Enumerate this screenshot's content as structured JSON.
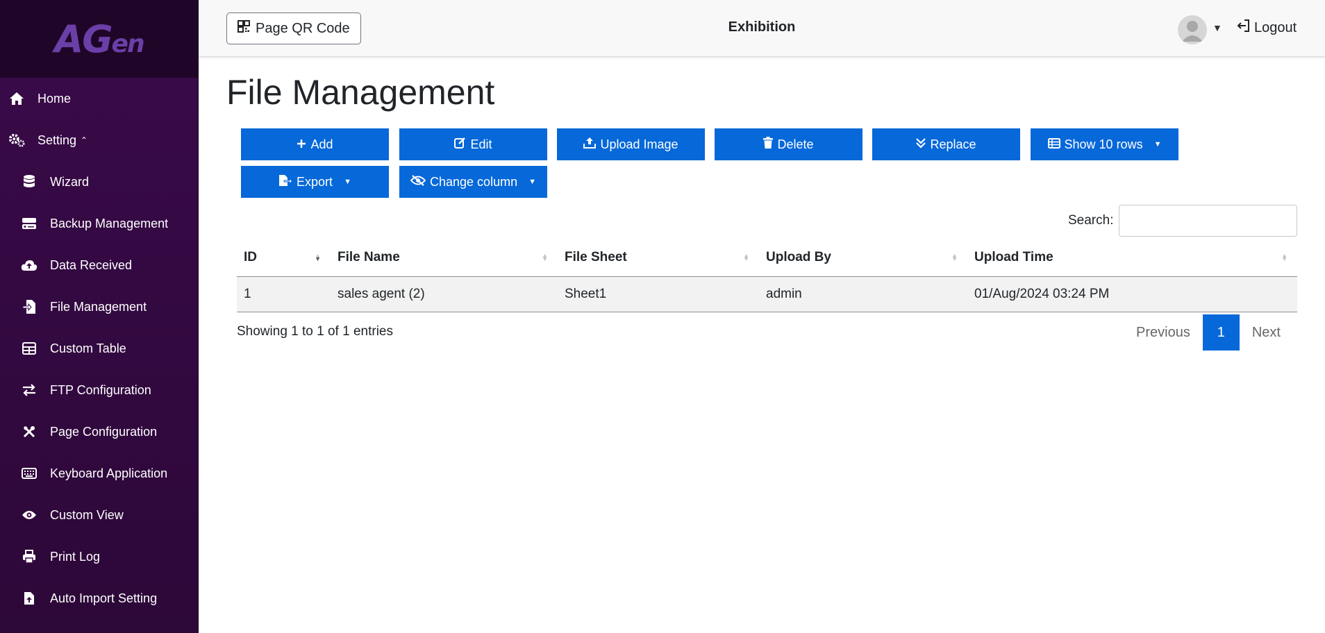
{
  "brand": {
    "logo_main": "AG",
    "logo_sub": "en"
  },
  "sidebar": {
    "items": [
      {
        "label": "Home",
        "icon": "home-icon"
      },
      {
        "label": "Setting",
        "icon": "gears-icon"
      },
      {
        "label": "Wizard",
        "icon": "database-icon"
      },
      {
        "label": "Backup Management",
        "icon": "server-icon"
      },
      {
        "label": "Data Received",
        "icon": "cloud-upload-icon"
      },
      {
        "label": "File Management",
        "icon": "file-import-icon"
      },
      {
        "label": "Custom Table",
        "icon": "table-icon"
      },
      {
        "label": "FTP Configuration",
        "icon": "exchange-icon"
      },
      {
        "label": "Page Configuration",
        "icon": "tools-icon"
      },
      {
        "label": "Keyboard Application",
        "icon": "keyboard-icon"
      },
      {
        "label": "Custom View",
        "icon": "eye-icon"
      },
      {
        "label": "Print Log",
        "icon": "printer-icon"
      },
      {
        "label": "Auto Import Setting",
        "icon": "file-upload-icon"
      }
    ]
  },
  "header": {
    "qr_button": "Page QR Code",
    "title": "Exhibition",
    "logout": "Logout"
  },
  "main": {
    "page_title": "File Management",
    "toolbar": {
      "add": "Add",
      "edit": "Edit",
      "upload_image": "Upload Image",
      "delete": "Delete",
      "replace": "Replace",
      "show_rows": "Show 10 rows",
      "export": "Export",
      "change_column": "Change column"
    },
    "search": {
      "label": "Search:",
      "value": ""
    },
    "table": {
      "columns": [
        "ID",
        "File Name",
        "File Sheet",
        "Upload By",
        "Upload Time"
      ],
      "rows": [
        [
          "1",
          "sales agent (2)",
          "Sheet1",
          "admin",
          "01/Aug/2024 03:24 PM"
        ]
      ]
    },
    "info": "Showing 1 to 1 of 1 entries",
    "pagination": {
      "previous": "Previous",
      "current": "1",
      "next": "Next"
    }
  },
  "colors": {
    "sidebar_bg": "#3a0a4a",
    "accent": "#0668d9",
    "logo": "#6b3fa8"
  }
}
